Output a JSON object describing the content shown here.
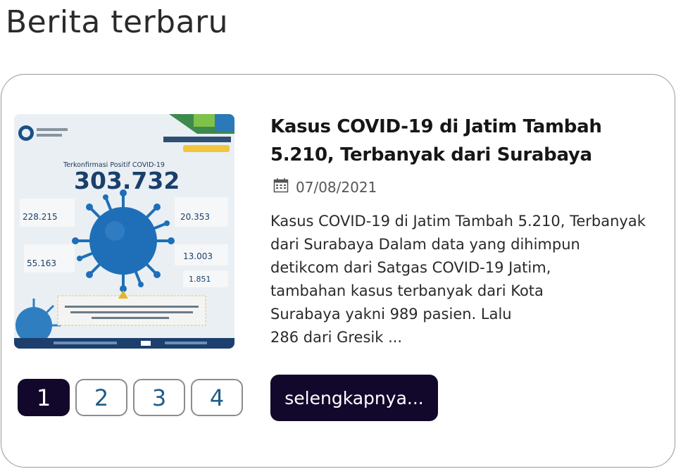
{
  "section": {
    "title": "Berita terbaru"
  },
  "article": {
    "headline": "Kasus COVID-19 di Jatim Tambah 5.210, Terbanyak dari Surabaya",
    "date": "07/08/2021",
    "excerpt_lines": [
      "Kasus COVID-19 di Jatim Tambah 5.210, Terbanyak",
      "dari Surabaya Dalam data yang dihimpun",
      "detikcom dari Satgas COVID-19 Jatim,",
      "tambahan kasus terbanyak dari Kota",
      "Surabaya yakni 989 pasien. Lalu",
      "286 dari Gresik ..."
    ],
    "read_more_label": "selengkapnya...",
    "thumbnail": {
      "heading": "Terkonfirmasi Positif COVID-19",
      "total": "303.732",
      "stat_left_top": "228.215",
      "stat_right_top": "20.353",
      "stat_left_bottom": "55.163",
      "stat_right_mid": "13.003",
      "stat_right_bottom": "1.851"
    }
  },
  "pagination": {
    "pages": [
      "1",
      "2",
      "3",
      "4"
    ],
    "active_page": "1"
  },
  "colors": {
    "primary_dark": "#12082b",
    "page_number_text": "#1f5c8a",
    "virus_blue": "#1e6fb8"
  },
  "icons": {
    "date": "calendar-icon"
  }
}
